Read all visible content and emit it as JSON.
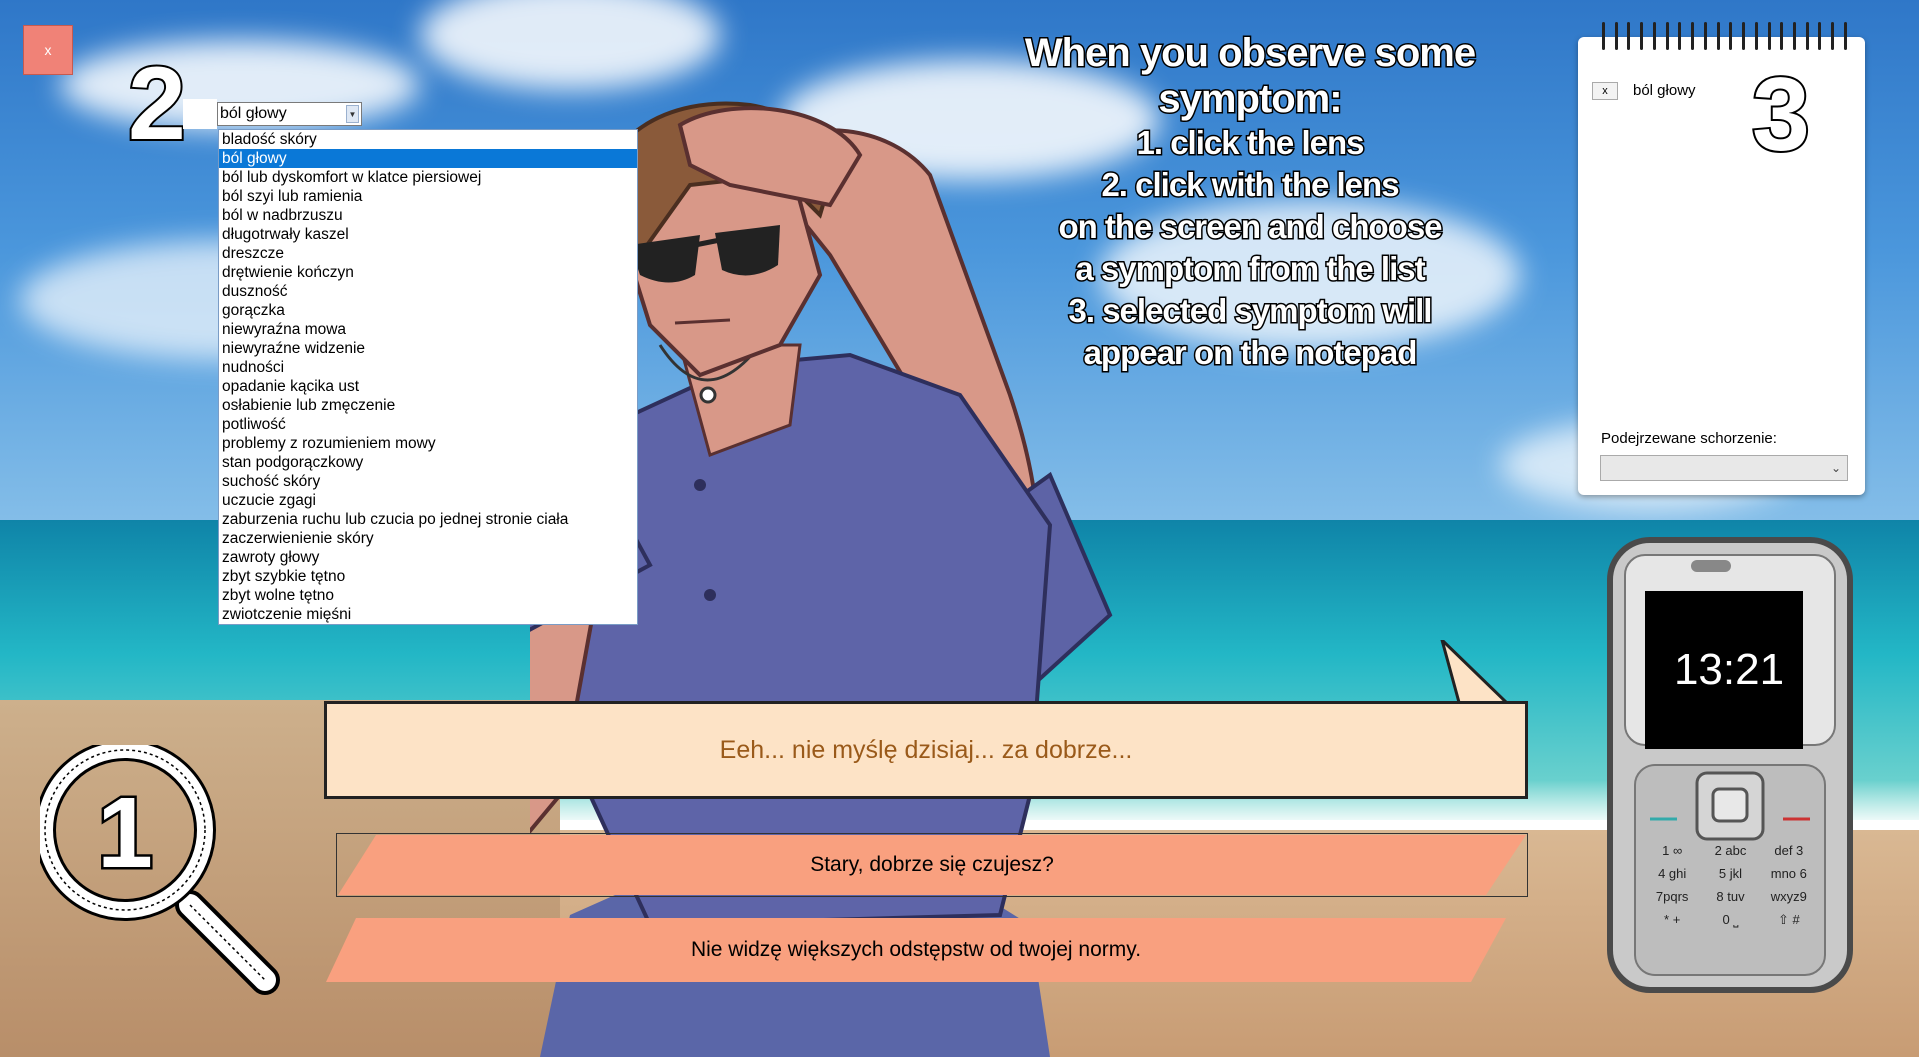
{
  "close_button": {
    "label": "x"
  },
  "step_numbers": {
    "two": "2",
    "three": "3",
    "one": "1"
  },
  "symptom_select": {
    "value": "ból głowy",
    "options": [
      "bladość skóry",
      "ból głowy",
      "ból lub dyskomfort w klatce piersiowej",
      "ból szyi lub ramienia",
      "ból w nadbrzuszu",
      "długotrwały kaszel",
      "dreszcze",
      "drętwienie kończyn",
      "duszność",
      "gorączka",
      "niewyraźna mowa",
      "niewyraźne widzenie",
      "nudności",
      "opadanie kącika ust",
      "osłabienie lub zmęczenie",
      "potliwość",
      "problemy z rozumieniem mowy",
      "stan podgorączkowy",
      "suchość skóry",
      "uczucie zgagi",
      "zaburzenia ruchu lub czucia po jednej stronie ciała",
      "zaczerwienienie skóry",
      "zawroty głowy",
      "zbyt szybkie tętno",
      "zbyt wolne tętno",
      "zwiotczenie mięśni"
    ],
    "selected_index": 1
  },
  "instructions": {
    "heading": "When you observe some symptom:",
    "lines": [
      "1. click the lens",
      "2. click with the lens",
      "on the screen and choose",
      "a symptom from the list",
      "3. selected symptom will",
      "appear on the notepad"
    ]
  },
  "notepad": {
    "remove_label": "x",
    "symptom": "ból głowy",
    "suspected_label": "Podejrzewane schorzenie:",
    "suspected_value": ""
  },
  "phone": {
    "time": "13:21",
    "keys": [
      "1 ∞",
      "2 abc",
      "def 3",
      "4 ghi",
      "5 jkl",
      "mno 6",
      "7pqrs",
      "8 tuv",
      "wxyz9",
      "* +",
      "0 ⎵",
      "⇧ #"
    ]
  },
  "dialogue": {
    "speech": "Eeh... nie myślę dzisiaj... za dobrze...",
    "choices": [
      "Stary, dobrze się czujesz?",
      "Nie widzę większych odstępstw od twojej normy."
    ]
  },
  "colors": {
    "speech_bg": "#fde3c6",
    "speech_text": "#9a5a1a",
    "choice_bg": "#f9a07f",
    "close_bg": "#f08277",
    "selected_option": "#0a78d7"
  }
}
